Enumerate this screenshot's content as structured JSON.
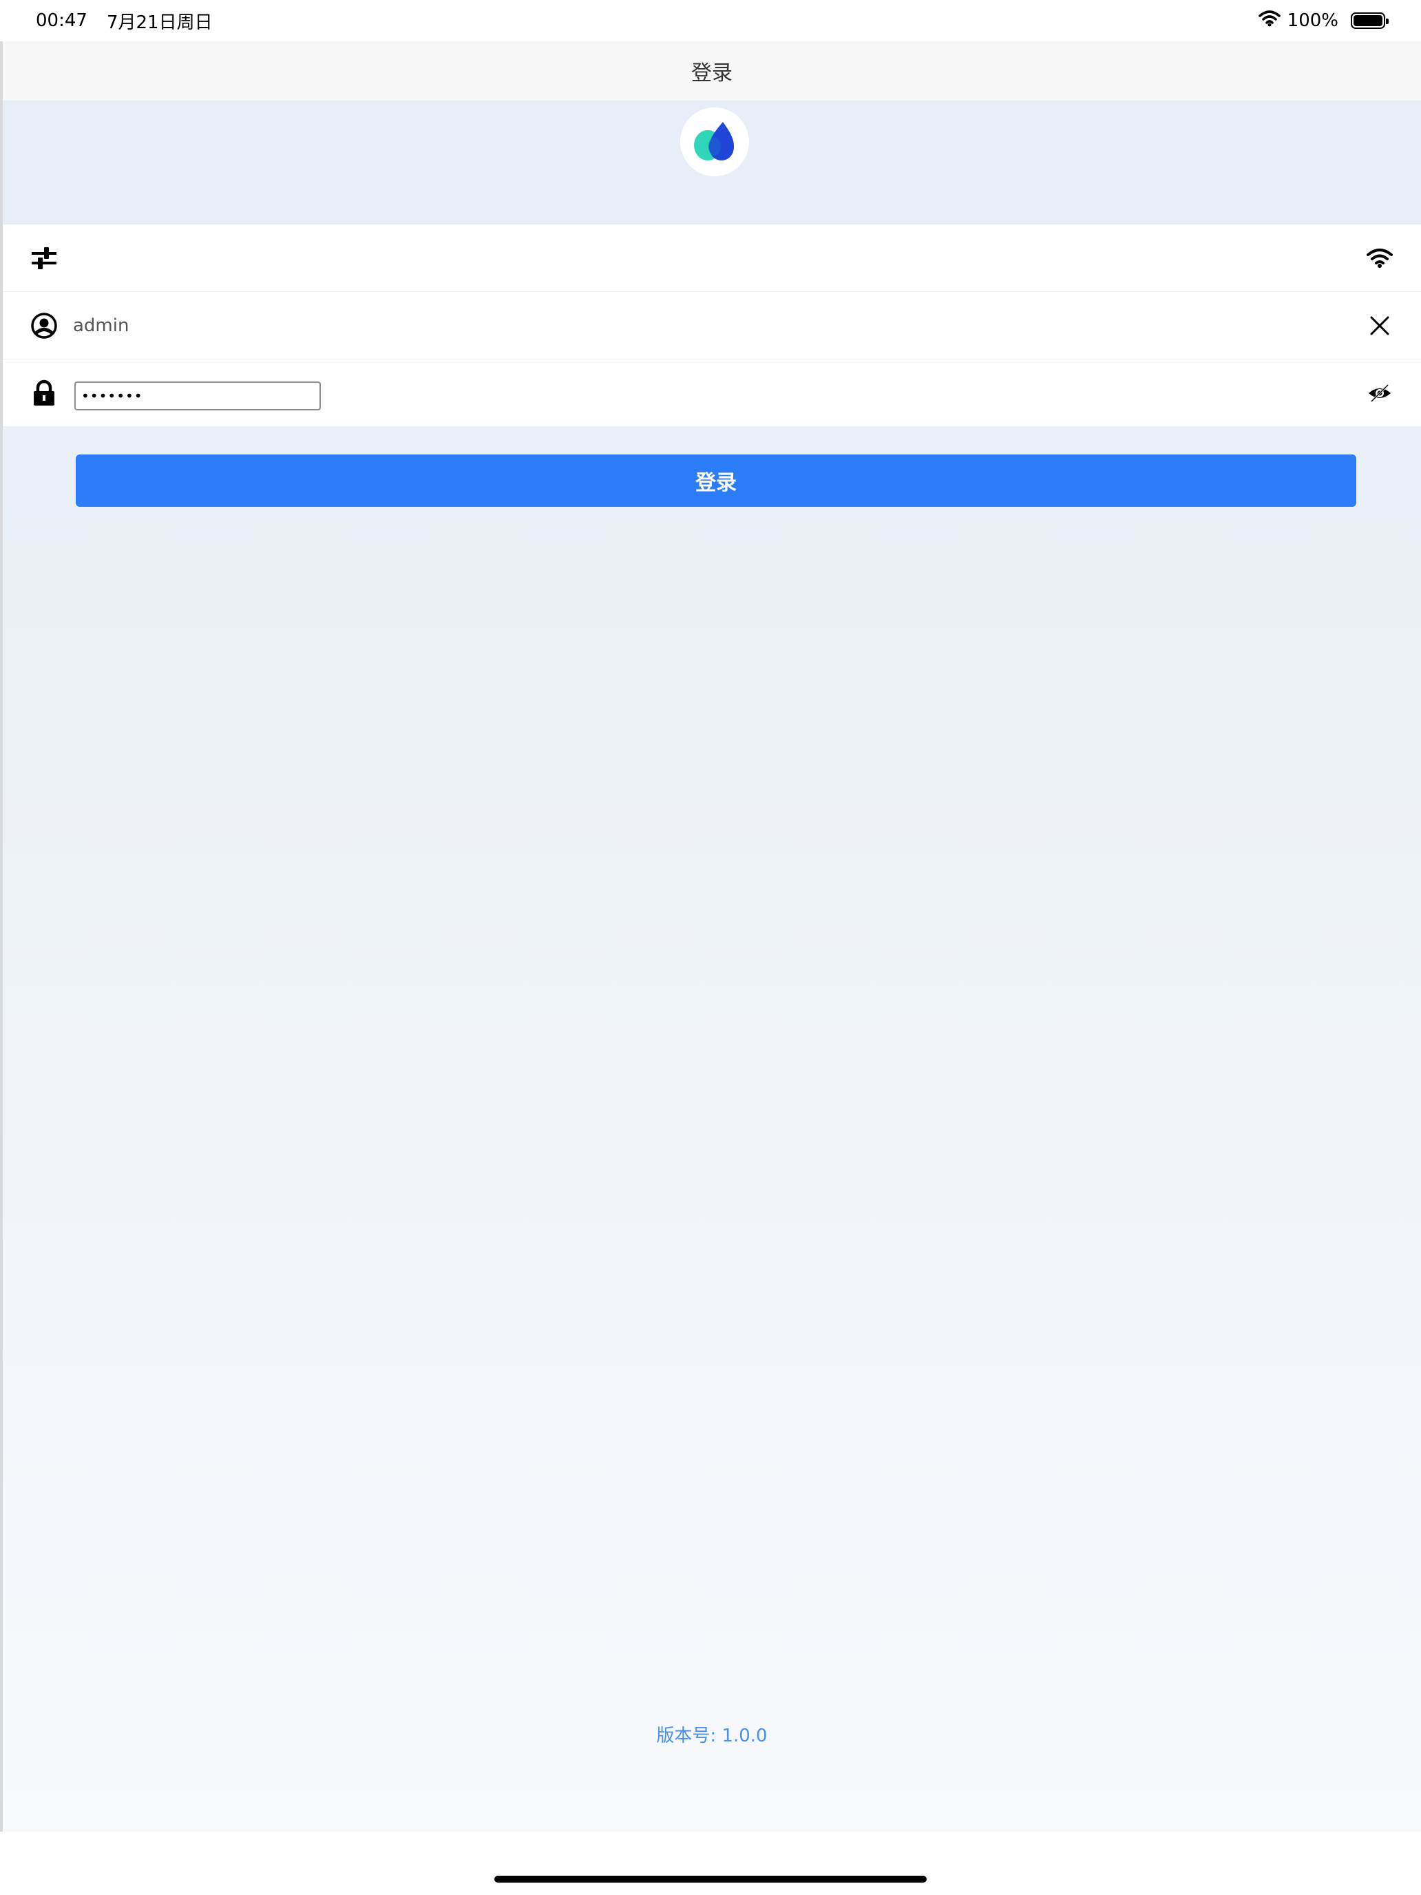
{
  "status_bar": {
    "time": "00:47",
    "date": "7月21日周日",
    "battery": "100%"
  },
  "nav": {
    "title": "登录"
  },
  "form": {
    "username_value": "admin",
    "password_value": "•••••••",
    "login_label": "登录"
  },
  "footer": {
    "version_label": "版本号:",
    "version_value": "1.0.0"
  },
  "colors": {
    "accent": "#2b7cf6",
    "version_text": "#4a8ff0",
    "logo_teal": "#2fd6b8",
    "logo_blue": "#2046d8"
  },
  "icons": {
    "settings": "sliders-icon",
    "network": "wifi-icon",
    "user": "user-circle-icon",
    "clear": "close-icon",
    "lock": "lock-icon",
    "visibility": "eye-off-icon"
  }
}
